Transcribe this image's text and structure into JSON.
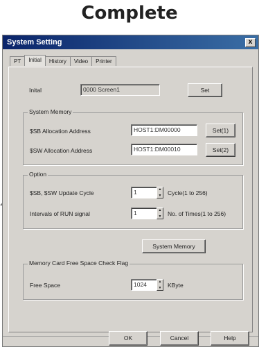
{
  "heading": "Complete",
  "window": {
    "title": "System Setting",
    "close_glyph": "x"
  },
  "tabs": [
    "PT",
    "Initial",
    "History",
    "Video",
    "Printer"
  ],
  "initial": {
    "label": "Inital",
    "value": "0000 Screen1",
    "set_label": "Set"
  },
  "system_memory": {
    "title": "System Memory",
    "rows": [
      {
        "label": "$SB Allocation Address",
        "value": "HOST1:DM00000",
        "button": "Set(1)"
      },
      {
        "label": "$SW Allocation Address",
        "value": "HOST1:DM00010",
        "button": "Set(2)"
      }
    ]
  },
  "option": {
    "title": "Option",
    "rows": [
      {
        "label": "$SB, $SW Update Cycle",
        "value": "1",
        "unit": "Cycle(1 to 256)"
      },
      {
        "label": "Intervals of RUN signal",
        "value": "1",
        "unit": "No. of Times(1 to 256)"
      }
    ]
  },
  "system_memory_button": "System Memory",
  "memory_card": {
    "title": "Memory Card Free Space Check Flag",
    "label": "Free Space",
    "value": "1024",
    "unit": "KByte"
  },
  "footer": {
    "ok": "OK",
    "cancel": "Cancel",
    "help": "Help"
  },
  "icons": {
    "arrow": "arrow-icon",
    "spin": "spin-arrows-icon",
    "close": "close-icon"
  }
}
